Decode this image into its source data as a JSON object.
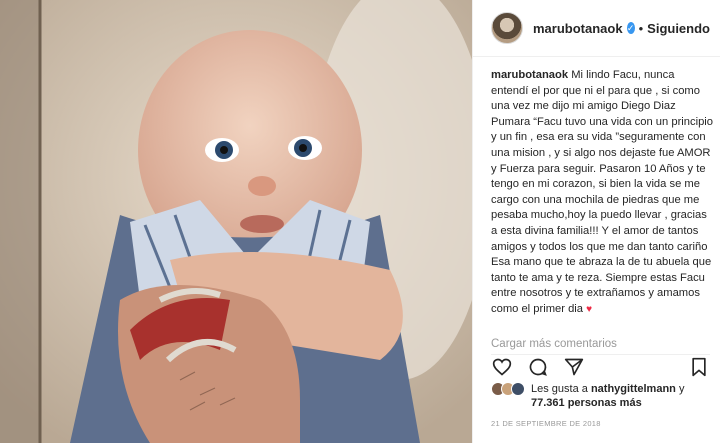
{
  "header": {
    "username": "marubotanaok",
    "separator": "•",
    "follow_label": "Siguiendo"
  },
  "caption": {
    "username": "marubotanaok",
    "text": "Mi lindo Facu, nunca entendí el por que ni el para que , si como una vez me dijo mi amigo Diego Diaz Pumara “Facu tuvo una vida con un principio y un fin , esa era su vida ”seguramente con una mision , y si algo nos dejaste fue AMOR y Fuerza para seguir. Pasaron 10 Años y te tengo en mi corazon, si bien la vida se me cargo con una mochila de piedras que me pesaba mucho,hoy la puedo llevar , gracias a esta divina familia!!! Y el amor de tantos amigos y todos los que me dan tanto cariño Esa mano que te abraza la de tu abuela que tanto te ama y te reza. Siempre estas Facu entre nosotros y te extrañamos y amamos como el primer dia",
    "heart": "♥"
  },
  "more_comments": "Cargar más comentarios",
  "likes": {
    "prefix": "Les gusta a",
    "user": "nathygittelmann",
    "conjunction": "y",
    "count": "77.361 personas más"
  },
  "date": "21 DE SEPTIEMBRE DE 2018",
  "icons": [
    "avatar",
    "verified-icon",
    "like-icon",
    "comment-icon",
    "share-icon",
    "save-icon"
  ],
  "colors": {
    "accent": "#3897f0",
    "heart": "#ed2944",
    "muted": "#999999"
  }
}
